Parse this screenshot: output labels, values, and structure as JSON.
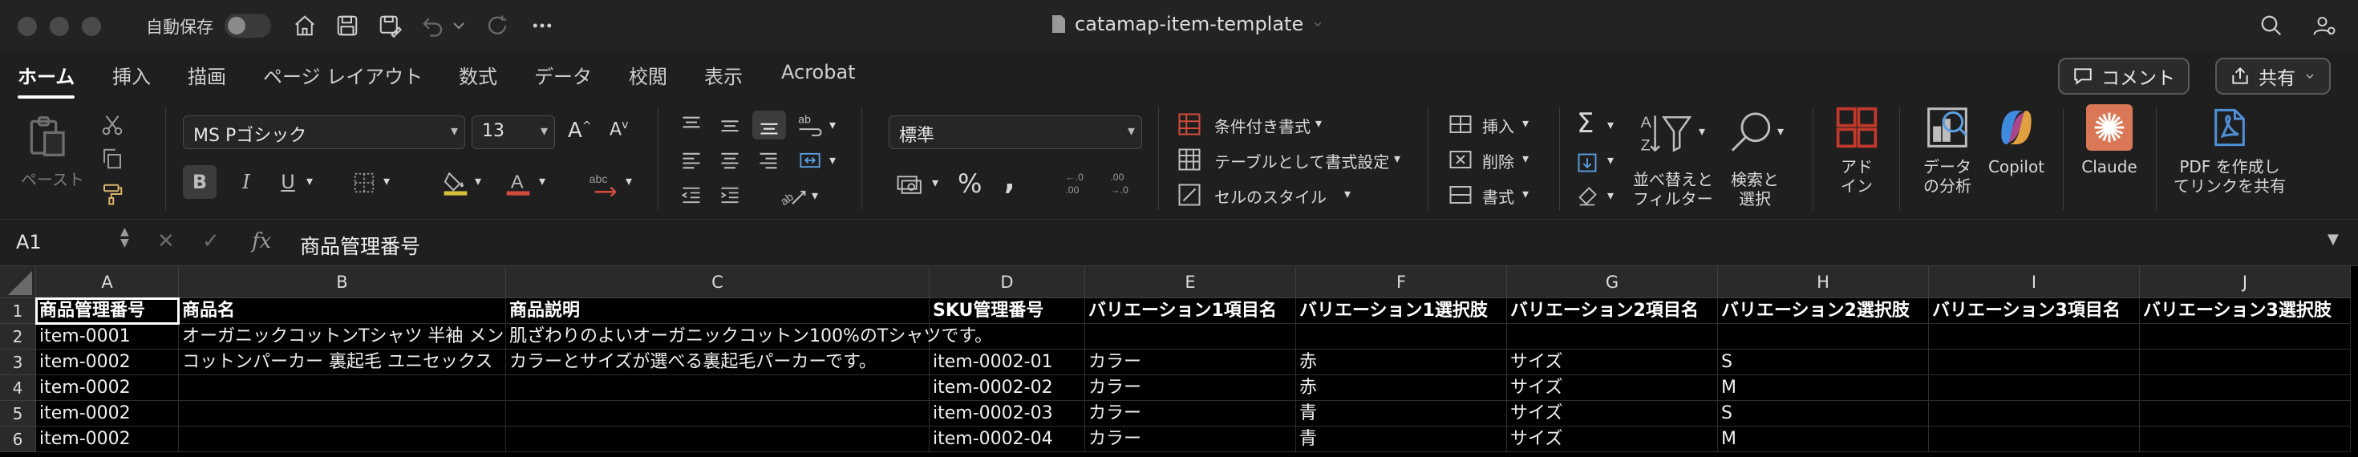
{
  "titlebar": {
    "autosave_label": "自動保存",
    "doc_title": "catamap-item-template"
  },
  "tabs": [
    "ホーム",
    "挿入",
    "描画",
    "ページ レイアウト",
    "数式",
    "データ",
    "校閲",
    "表示",
    "Acrobat"
  ],
  "actions": {
    "comment": "コメント",
    "share": "共有"
  },
  "ribbon": {
    "paste": "ペースト",
    "font_name": "MS Pゴシック",
    "font_size": "13",
    "number_format": "標準",
    "conditional_format": "条件付き書式",
    "format_as_table": "テーブルとして書式設定",
    "cell_styles": "セルのスタイル",
    "insert": "挿入",
    "delete": "削除",
    "format": "書式",
    "sort_filter_1": "並べ替えと",
    "sort_filter_2": "フィルター",
    "find_select_1": "検索と",
    "find_select_2": "選択",
    "addins_1": "アド",
    "addins_2": "イン",
    "analyze_1": "データ",
    "analyze_2": "の分析",
    "copilot": "Copilot",
    "claude": "Claude",
    "pdf_1": "PDF を作成し",
    "pdf_2": "てリンクを共有",
    "bold": "B",
    "italic": "I",
    "underline": "U"
  },
  "formula_bar": {
    "name_box": "A1",
    "fx": "fx",
    "content": "商品管理番号"
  },
  "colors": {
    "accent": "#ffffff",
    "cond_format": "#d04b3c",
    "addins": "#c0392b",
    "claude": "#d97757",
    "pdf": "#4f8fd6"
  },
  "grid": {
    "columns": [
      "A",
      "B",
      "C",
      "D",
      "E",
      "F",
      "G",
      "H",
      "I",
      "J"
    ],
    "rows": [
      "1",
      "2",
      "3",
      "4",
      "5",
      "6"
    ],
    "cells": [
      [
        "商品管理番号",
        "商品名",
        "商品説明",
        "SKU管理番号",
        "バリエーション1項目名",
        "バリエーション1選択肢",
        "バリエーション2項目名",
        "バリエーション2選択肢",
        "バリエーション3項目名",
        "バリエーション3選択肢"
      ],
      [
        "item-0001",
        "オーガニックコットンTシャツ 半袖 メン",
        "肌ざわりのよいオーガニックコットン100%のTシャツです。",
        "",
        "",
        "",
        "",
        "",
        "",
        ""
      ],
      [
        "item-0002",
        "コットンパーカー 裏起毛 ユニセックス",
        "カラーとサイズが選べる裏起毛パーカーです。",
        "item-0002-01",
        "カラー",
        "赤",
        "サイズ",
        "S",
        "",
        ""
      ],
      [
        "item-0002",
        "",
        "",
        "item-0002-02",
        "カラー",
        "赤",
        "サイズ",
        "M",
        "",
        ""
      ],
      [
        "item-0002",
        "",
        "",
        "item-0002-03",
        "カラー",
        "青",
        "サイズ",
        "S",
        "",
        ""
      ],
      [
        "item-0002",
        "",
        "",
        "item-0002-04",
        "カラー",
        "青",
        "サイズ",
        "M",
        "",
        ""
      ]
    ]
  }
}
